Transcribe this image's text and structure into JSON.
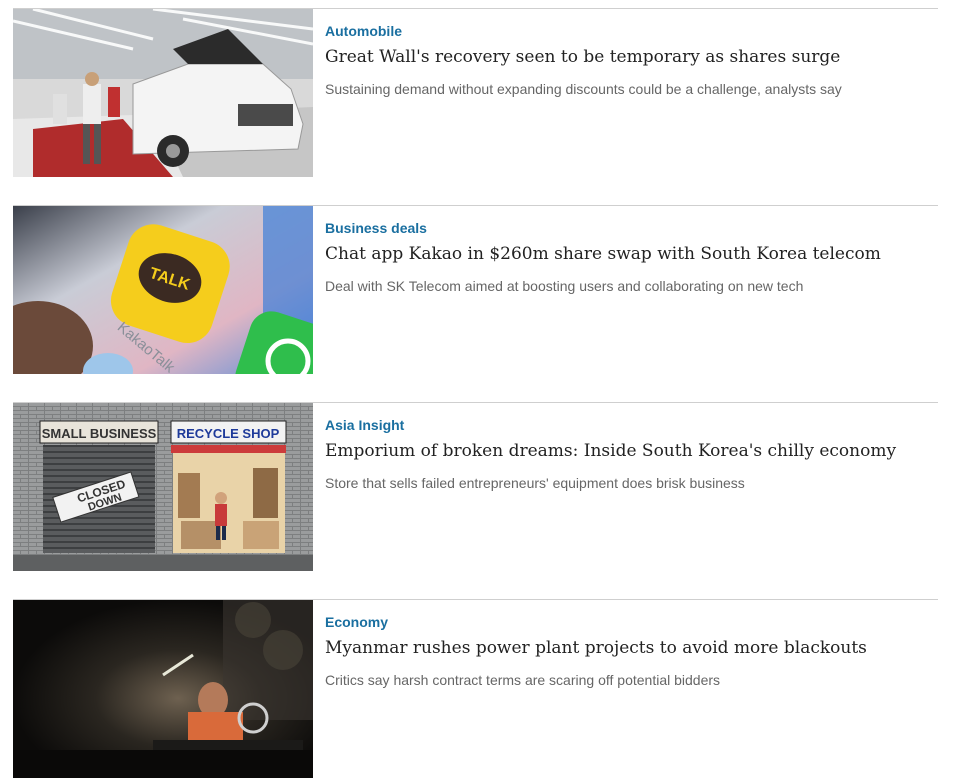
{
  "articles": [
    {
      "category": "Automobile",
      "headline": "Great Wall's recovery seen to be temporary as shares surge",
      "summary": "Sustaining demand without expanding discounts could be a challenge, analysts say",
      "image": "car-factory-photo"
    },
    {
      "category": "Business deals",
      "headline": "Chat app Kakao in $260m share swap with South Korea telecom",
      "summary": "Deal with SK Telecom aimed at boosting users and collaborating on new tech",
      "image": "kakaotalk-app-icon-photo",
      "image_text": {
        "talk": "TALK",
        "app_name": "KakaoTalk"
      }
    },
    {
      "category": "Asia Insight",
      "headline": "Emporium of broken dreams: Inside South Korea's chilly economy",
      "summary": "Store that sells failed entrepreneurs' equipment does brisk business",
      "image": "storefront-illustration",
      "image_text": {
        "left_sign": "SMALL BUSINESS",
        "right_sign": "RECYCLE SHOP",
        "closed_sign_line1": "CLOSED",
        "closed_sign_line2": "DOWN"
      }
    },
    {
      "category": "Economy",
      "headline": "Myanmar rushes power plant projects to avoid more blackouts",
      "summary": "Critics say harsh contract terms are scaring off potential bidders",
      "image": "dark-workshop-photo"
    }
  ],
  "colors": {
    "category": "#1a6fa0",
    "headline": "#222222",
    "summary": "#666666",
    "divider": "#cfcfcf"
  }
}
